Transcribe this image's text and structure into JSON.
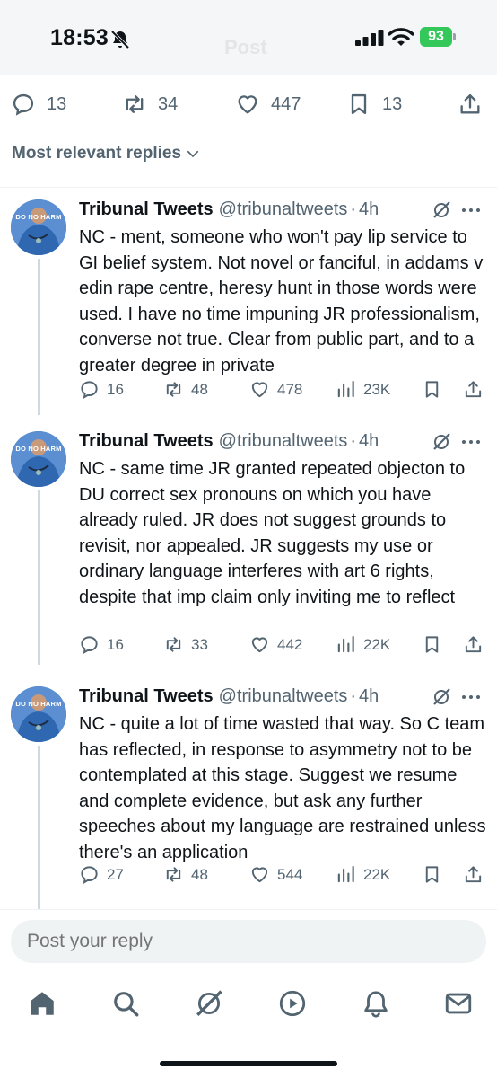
{
  "status_bar": {
    "time": "18:53",
    "ghost_title": "Post",
    "battery": "93"
  },
  "main_post_actions": {
    "replies": "13",
    "reposts": "34",
    "likes": "447",
    "bookmarks": "13"
  },
  "sort": {
    "label": "Most relevant replies"
  },
  "replies": [
    {
      "name": "Tribunal Tweets",
      "handle": "@tribunaltweets",
      "separator": "·",
      "time": "4h",
      "avatar_text": "DO NO HARM",
      "text": "NC - ment, someone who won't pay lip service to GI belief system. Not novel or fanciful, in addams v edin rape centre, heresy hunt in those words were used. I have no time impuning JR professionalism, converse not true. Clear from public part, and to a greater degree in private",
      "replies": "16",
      "reposts": "48",
      "likes": "478",
      "views": "23K"
    },
    {
      "name": "Tribunal Tweets",
      "handle": "@tribunaltweets",
      "separator": "·",
      "time": "4h",
      "avatar_text": "DO NO HARM",
      "text": "NC - same time JR granted repeated objecton to DU correct sex pronouns on which you have already ruled. JR does not suggest grounds to revisit, nor appealed. JR suggests my use or ordinary language interferes with art 6 rights, despite that imp claim only inviting me to reflect",
      "replies": "16",
      "reposts": "33",
      "likes": "442",
      "views": "22K"
    },
    {
      "name": "Tribunal Tweets",
      "handle": "@tribunaltweets",
      "separator": "·",
      "time": "4h",
      "avatar_text": "DO NO HARM",
      "text": "NC - quite a lot of time wasted that way. So C team has reflected, in response to asymmetry not to be contemplated at this stage. Suggest we resume and complete evidence, but ask any further speeches about my language are restrained unless there's an application",
      "replies": "27",
      "reposts": "48",
      "likes": "544",
      "views": "22K"
    }
  ],
  "reply_input": {
    "placeholder": "Post your reply"
  },
  "icons": {
    "reply": "reply-icon",
    "repost": "repost-icon",
    "like": "heart-icon",
    "bookmark": "bookmark-icon",
    "share": "share-icon",
    "views": "views-icon",
    "grok": "grok-icon",
    "more": "more-icon",
    "nav": [
      "home-icon",
      "search-icon",
      "grok-icon",
      "video-icon",
      "notifications-icon",
      "messages-icon"
    ]
  },
  "colors": {
    "text": "#0f1419",
    "secondary": "#536471",
    "battery": "#34c759",
    "input_bg": "#eff3f4",
    "avatar": "#3a78c2"
  }
}
